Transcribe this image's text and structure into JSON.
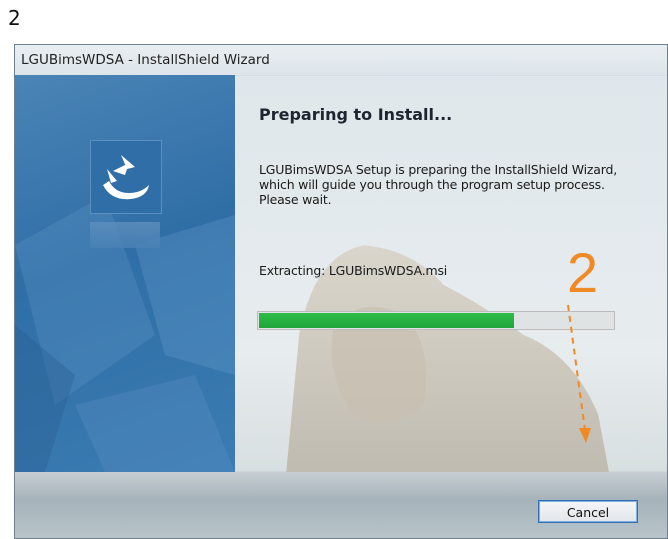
{
  "step_label": "2",
  "window": {
    "title": "LGUBimsWDSA - InstallShield Wizard"
  },
  "main": {
    "heading": "Preparing to Install...",
    "description_lines": [
      "LGUBimsWDSA Setup is preparing the InstallShield Wizard,",
      "which will guide you through the program setup process.",
      "Please wait."
    ],
    "status": "Extracting: LGUBimsWDSA.msi",
    "progress_fraction": 0.72
  },
  "buttons": {
    "cancel": "Cancel"
  },
  "annotation": {
    "number": "2",
    "color": "#f08a24"
  },
  "colors": {
    "progress_green": "#22a83d",
    "panel_blue": "#3a77ad"
  }
}
